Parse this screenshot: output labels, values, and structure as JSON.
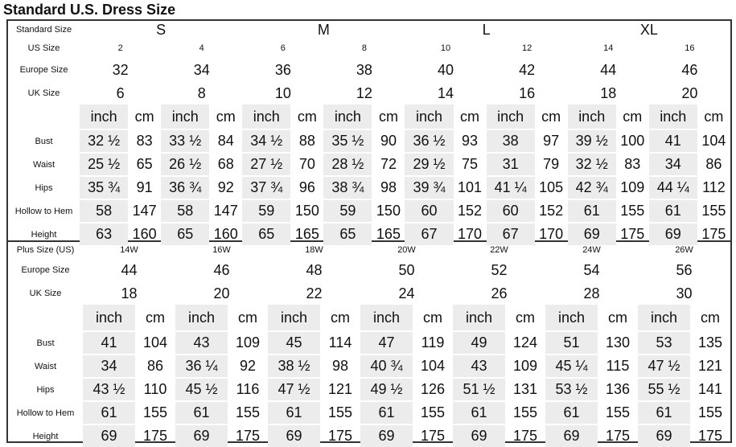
{
  "title": "Standard U.S. Dress Size",
  "standard": {
    "labels": {
      "standard_size": "Standard Size",
      "us_size": "US Size",
      "europe_size": "Europe Size",
      "uk_size": "UK Size",
      "bust": "Bust",
      "waist": "Waist",
      "hips": "Hips",
      "hollow_to_hem": "Hollow to Hem",
      "height": "Height"
    },
    "standard_sizes": [
      "S",
      "M",
      "L",
      "XL"
    ],
    "us_sizes": [
      "2",
      "4",
      "6",
      "8",
      "10",
      "12",
      "14",
      "16"
    ],
    "europe_sizes": [
      "32",
      "34",
      "36",
      "38",
      "40",
      "42",
      "44",
      "46"
    ],
    "uk_sizes": [
      "6",
      "8",
      "10",
      "12",
      "14",
      "16",
      "18",
      "20"
    ],
    "unit_inch": "inch",
    "unit_cm": "cm",
    "rows": {
      "bust": [
        [
          "32 ½",
          "83"
        ],
        [
          "33 ½",
          "84"
        ],
        [
          "34 ½",
          "88"
        ],
        [
          "35 ½",
          "90"
        ],
        [
          "36 ½",
          "93"
        ],
        [
          "38",
          "97"
        ],
        [
          "39 ½",
          "100"
        ],
        [
          "41",
          "104"
        ]
      ],
      "waist": [
        [
          "25 ½",
          "65"
        ],
        [
          "26 ½",
          "68"
        ],
        [
          "27 ½",
          "70"
        ],
        [
          "28 ½",
          "72"
        ],
        [
          "29 ½",
          "75"
        ],
        [
          "31",
          "79"
        ],
        [
          "32 ½",
          "83"
        ],
        [
          "34",
          "86"
        ]
      ],
      "hips": [
        [
          "35 ¾",
          "91"
        ],
        [
          "36 ¾",
          "92"
        ],
        [
          "37 ¾",
          "96"
        ],
        [
          "38 ¾",
          "98"
        ],
        [
          "39 ¾",
          "101"
        ],
        [
          "41 ¼",
          "105"
        ],
        [
          "42 ¾",
          "109"
        ],
        [
          "44 ¼",
          "112"
        ]
      ],
      "hollow_to_hem": [
        [
          "58",
          "147"
        ],
        [
          "58",
          "147"
        ],
        [
          "59",
          "150"
        ],
        [
          "59",
          "150"
        ],
        [
          "60",
          "152"
        ],
        [
          "60",
          "152"
        ],
        [
          "61",
          "155"
        ],
        [
          "61",
          "155"
        ]
      ],
      "height": [
        [
          "63",
          "160"
        ],
        [
          "65",
          "160"
        ],
        [
          "65",
          "165"
        ],
        [
          "65",
          "165"
        ],
        [
          "67",
          "170"
        ],
        [
          "67",
          "170"
        ],
        [
          "69",
          "175"
        ],
        [
          "69",
          "175"
        ]
      ]
    }
  },
  "plus": {
    "labels": {
      "plus_size": "Plus Size (US)",
      "europe_size": "Europe Size",
      "uk_size": "UK Size",
      "bust": "Bust",
      "waist": "Waist",
      "hips": "Hips",
      "hollow_to_hem": "Hollow to Hem",
      "height": "Height"
    },
    "plus_sizes": [
      "14W",
      "16W",
      "18W",
      "20W",
      "22W",
      "24W",
      "26W"
    ],
    "europe_sizes": [
      "44",
      "46",
      "48",
      "50",
      "52",
      "54",
      "56"
    ],
    "uk_sizes": [
      "18",
      "20",
      "22",
      "24",
      "26",
      "28",
      "30"
    ],
    "unit_inch": "inch",
    "unit_cm": "cm",
    "rows": {
      "bust": [
        [
          "41",
          "104"
        ],
        [
          "43",
          "109"
        ],
        [
          "45",
          "114"
        ],
        [
          "47",
          "119"
        ],
        [
          "49",
          "124"
        ],
        [
          "51",
          "130"
        ],
        [
          "53",
          "135"
        ]
      ],
      "waist": [
        [
          "34",
          "86"
        ],
        [
          "36 ¼",
          "92"
        ],
        [
          "38 ½",
          "98"
        ],
        [
          "40 ¾",
          "104"
        ],
        [
          "43",
          "109"
        ],
        [
          "45 ¼",
          "115"
        ],
        [
          "47 ½",
          "121"
        ]
      ],
      "hips": [
        [
          "43 ½",
          "110"
        ],
        [
          "45 ½",
          "116"
        ],
        [
          "47 ½",
          "121"
        ],
        [
          "49 ½",
          "126"
        ],
        [
          "51 ½",
          "131"
        ],
        [
          "53 ½",
          "136"
        ],
        [
          "55 ½",
          "141"
        ]
      ],
      "hollow_to_hem": [
        [
          "61",
          "155"
        ],
        [
          "61",
          "155"
        ],
        [
          "61",
          "155"
        ],
        [
          "61",
          "155"
        ],
        [
          "61",
          "155"
        ],
        [
          "61",
          "155"
        ],
        [
          "61",
          "155"
        ]
      ],
      "height": [
        [
          "69",
          "175"
        ],
        [
          "69",
          "175"
        ],
        [
          "69",
          "175"
        ],
        [
          "69",
          "175"
        ],
        [
          "69",
          "175"
        ],
        [
          "69",
          "175"
        ],
        [
          "69",
          "175"
        ]
      ]
    }
  }
}
